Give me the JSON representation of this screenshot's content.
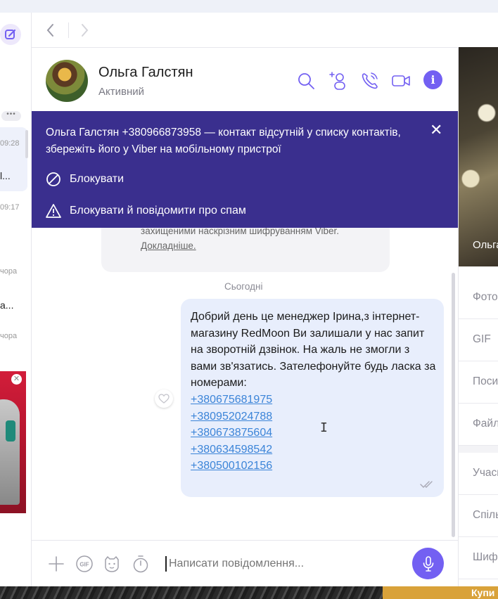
{
  "left": {
    "times": [
      "09:28",
      "09:17",
      "чора",
      "чора"
    ],
    "snippets": [
      "l...",
      "a..."
    ],
    "more_dots": "•••",
    "ad_close": "✕"
  },
  "chat": {
    "contact_name": "Ольга Галстян",
    "status": "Активний",
    "info_glyph": "i"
  },
  "banner": {
    "text": "Ольга Галстян +380966873958 — контакт відсутній у списку контактів, збережіть його у Viber на мобільному пристрої",
    "close": "✕",
    "block_label": "Блокувати",
    "block_report_label": "Блокувати й повідомити про спам"
  },
  "infocard": {
    "line": "захищеними наскрізним шифруванням Viber.",
    "link": "Докладніше."
  },
  "date_separator": "Сьогодні",
  "message": {
    "text": "Добрий день це менеджер Ірина,з інтернет-магазину RedMoon Ви залишали у нас запит на зворотній дзвінок. На жаль не змогли з вами зв'язатись. Зателефонуйте будь ласка за номерами:",
    "phones": [
      "+380675681975",
      "+380952024788",
      "+380673875604",
      "+380634598542",
      "+380500102156"
    ]
  },
  "input": {
    "placeholder": "Написати повідомлення..."
  },
  "right_panel": {
    "photo_name": "Ольга",
    "items": [
      "Фото",
      "GIF",
      "Посилання",
      "Файли",
      "Учасники",
      "Спільні",
      "Шифрування"
    ]
  },
  "bottom_ad": "Купи",
  "colors": {
    "accent": "#7360f2",
    "banner": "#3a2f8e",
    "bubble": "#e8eefc",
    "link": "#3b84d8"
  }
}
